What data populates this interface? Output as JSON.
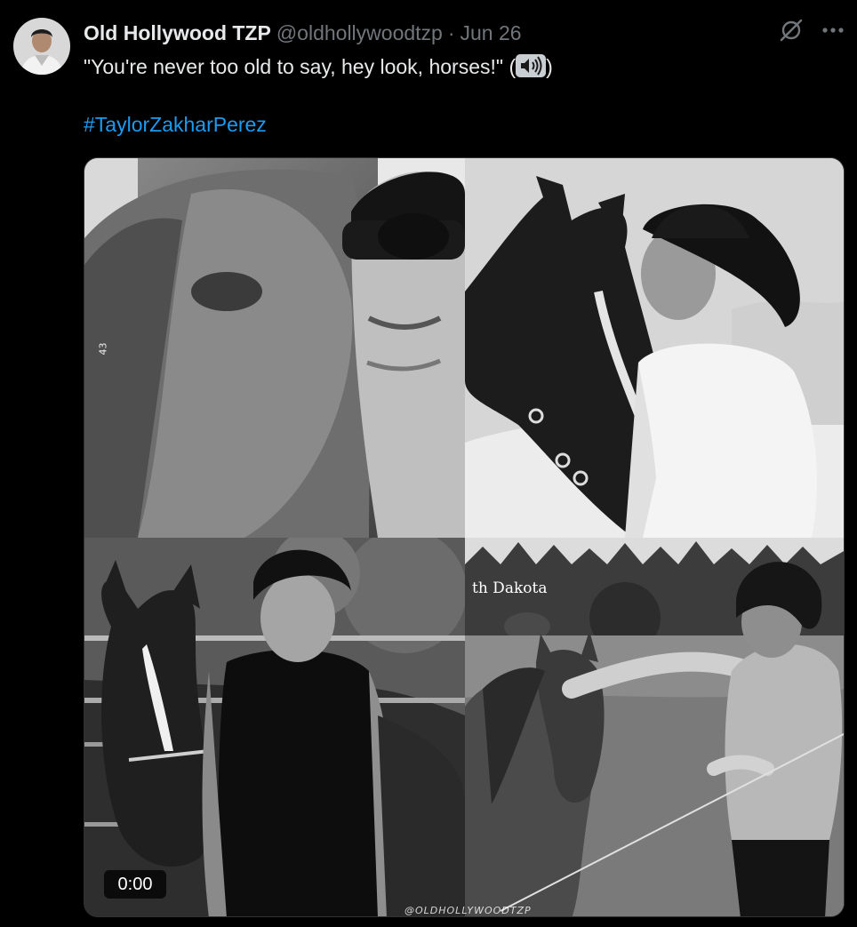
{
  "tweet": {
    "display_name": "Old Hollywood TZP",
    "handle": "@oldhollywoodtzp",
    "separator": "·",
    "date": "Jun 26",
    "text_before": "\"You're never too old to say, hey look, horses!\" (",
    "text_after": ")",
    "speaker_icon": "speaker-high-volume-icon",
    "hashtag": "#TaylorZakharPerez"
  },
  "media": {
    "overlay_place": "th Dakota",
    "side_number": "43",
    "watermark": "@OLDHOLLYWOODTZP",
    "timestamp": "0:00"
  },
  "icons": {
    "grok": "grok-icon",
    "more": "more-icon"
  },
  "colors": {
    "background": "#000000",
    "text": "#e7e9ea",
    "secondary": "#71767b",
    "link": "#1d9bf0"
  }
}
